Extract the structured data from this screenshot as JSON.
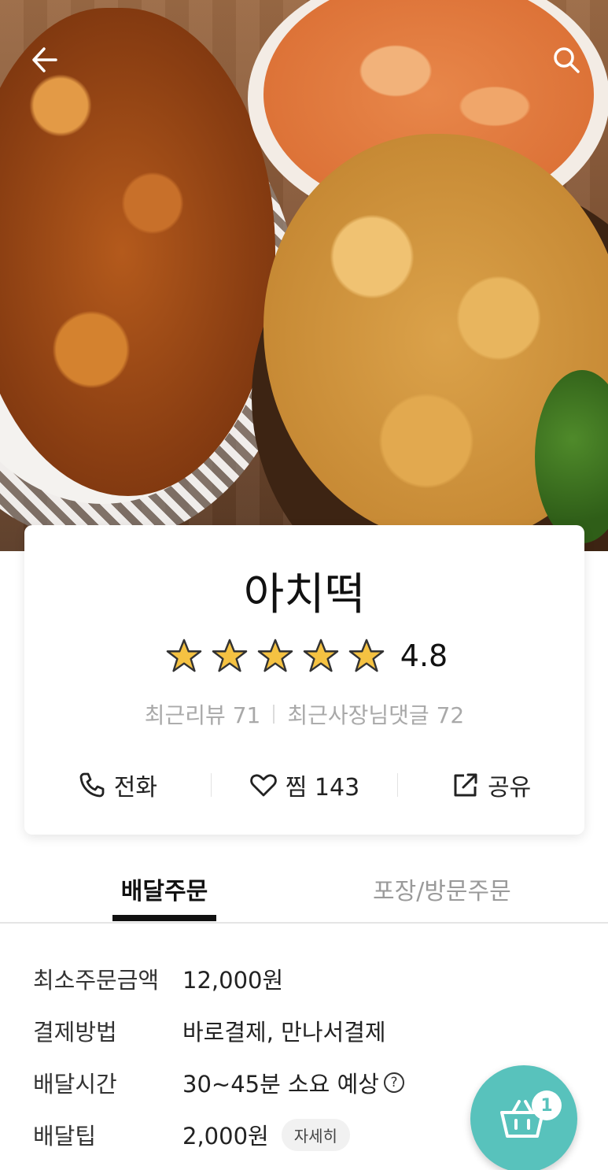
{
  "store": {
    "name": "아치떡",
    "rating": "4.8",
    "stars": 5,
    "recent_reviews": "최근리뷰 71",
    "owner_replies": "최근사장님댓글 72"
  },
  "actions": {
    "call_label": "전화",
    "favorite_label": "찜 143",
    "share_label": "공유"
  },
  "tabs": {
    "delivery": "배달주문",
    "pickup": "포장/방문주문"
  },
  "info": {
    "min_order_label": "최소주문금액",
    "min_order_value": "12,000원",
    "payment_label": "결제방법",
    "payment_value": "바로결제, 만나서결제",
    "time_label": "배달시간",
    "time_value": "30~45분 소요 예상",
    "tip_label": "배달팁",
    "tip_value": "2,000원",
    "detail_label": "자세히",
    "help_glyph": "?"
  },
  "cart": {
    "count": "1"
  },
  "icons": {
    "back": "back-arrow-icon",
    "search": "search-icon",
    "star": "star-icon",
    "phone": "phone-icon",
    "heart": "heart-icon",
    "share": "share-icon",
    "cart": "cart-icon",
    "help": "help-circle-icon"
  },
  "colors": {
    "accent": "#58c2bc",
    "star": "#f5c242",
    "muted_text": "#a9a9a9"
  }
}
